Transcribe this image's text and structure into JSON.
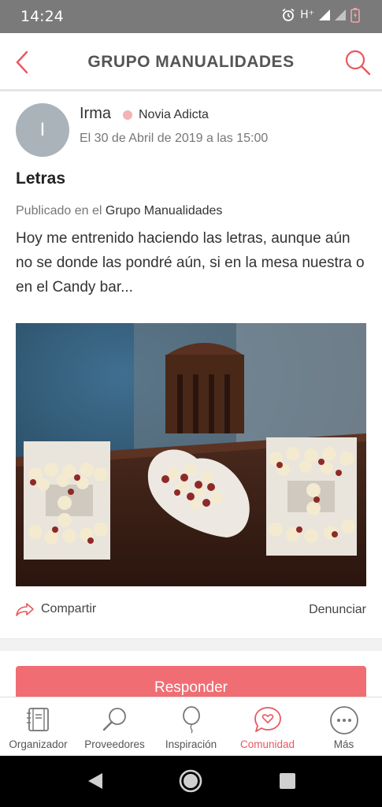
{
  "status_bar": {
    "time": "14:24",
    "network": "H⁺"
  },
  "header": {
    "title": "GRUPO MANUALIDADES"
  },
  "post": {
    "avatar_initial": "I",
    "author": "Irma",
    "badge": "Novia Adicta",
    "date": "El 30 de Abril de 2019 a las 15:00",
    "title": "Letras",
    "published_prefix": "Publicado en el",
    "group": "Grupo Manualidades",
    "body": "Hoy me entrenido haciendo las letras, aunque aún no se donde las pondré aún, si en la mesa nuestra o en el Candy bar...",
    "share_label": "Compartir",
    "report_label": "Denunciar"
  },
  "reply_button": "Responder",
  "bottom_nav": [
    {
      "label": "Organizador",
      "icon": "planner-icon",
      "active": false
    },
    {
      "label": "Proveedores",
      "icon": "search-icon",
      "active": false
    },
    {
      "label": "Inspiración",
      "icon": "balloon-icon",
      "active": false
    },
    {
      "label": "Comunidad",
      "icon": "chat-heart-icon",
      "active": true
    },
    {
      "label": "Más",
      "icon": "more-icon",
      "active": false
    }
  ],
  "colors": {
    "accent": "#e8585f",
    "button": "#f06e73",
    "status_bar": "#7a7a7a"
  }
}
